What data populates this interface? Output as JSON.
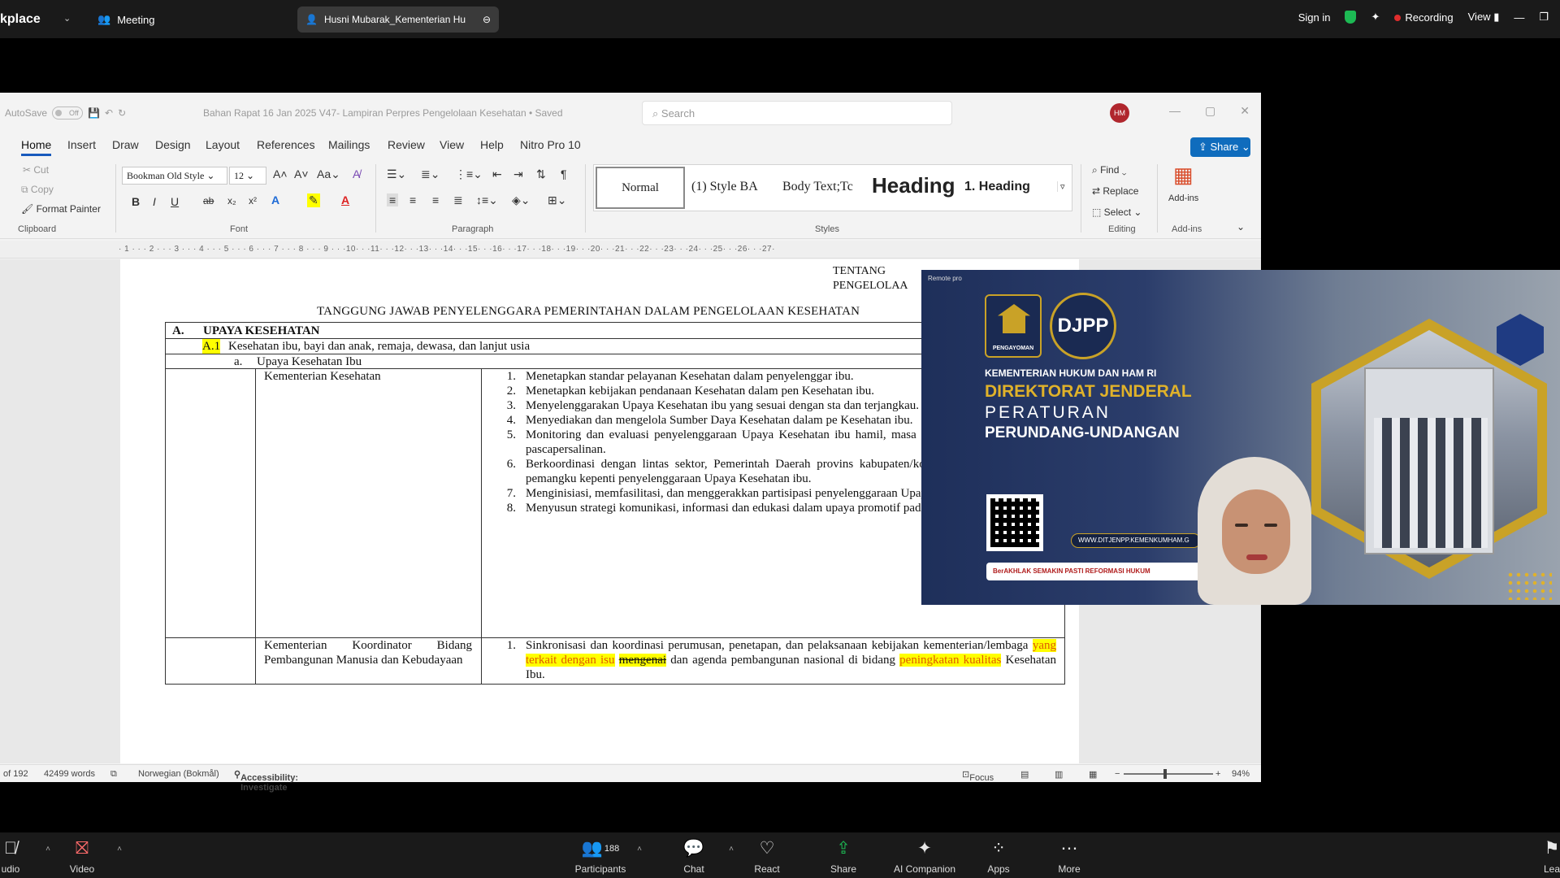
{
  "zoom_top": {
    "app_name": "kplace",
    "meeting_label": "Meeting",
    "share_label": "Husni Mubarak_Kementerian Hu",
    "sign_in": "Sign in",
    "recording": "Recording",
    "view": "View"
  },
  "word": {
    "autosave_label": "AutoSave",
    "autosave_state": "Off",
    "doc_title": "Bahan Rapat 16 Jan 2025 V47- Lampiran Perpres Pengelolaan Kesehatan • Saved",
    "search_placeholder": "Search",
    "avatar_initials": "HM",
    "tabs": [
      "Home",
      "Insert",
      "Draw",
      "Design",
      "Layout",
      "References",
      "Mailings",
      "Review",
      "View",
      "Help",
      "Nitro Pro 10"
    ],
    "share_label": "Share",
    "clipboard": {
      "cut": "Cut",
      "copy": "Copy",
      "format_painter": "Format Painter",
      "label": "Clipboard"
    },
    "font": {
      "name": "Bookman Old Style",
      "size": "12",
      "label": "Font"
    },
    "paragraph_label": "Paragraph",
    "styles": {
      "normal": "Normal",
      "style_ba": "(1)  Style BA",
      "body_text": "Body Text;Tc",
      "heading": "Heading",
      "heading1": "1.  Heading",
      "label": "Styles"
    },
    "editing": {
      "find": "Find",
      "replace": "Replace",
      "select": "Select",
      "label": "Editing"
    },
    "addins": {
      "button": "Add-ins",
      "label": "Add-ins"
    },
    "ruler_marks": "· 1 · · · 2 · · · 3 · · · 4 · · · 5 · · · 6 · · · 7 · · · 8 · · · 9 · · ·10· · ·11· · ·12· · ·13· · ·14· · ·15· · ·16· · ·17· · ·18· · ·19· · ·20· · ·21· · ·22· · ·23· · ·24· · ·25· · ·26· · ·27·",
    "document": {
      "tentang_1": "TENTANG",
      "tentang_2": "PENGELOLAA",
      "heading": "TANGGUNG JAWAB PENYELENGGARA PEMERINTAHAN DALAM PENGELOLAAN KESEHATAN",
      "section_letter": "A.",
      "section_title": "UPAYA KESEHATAN",
      "sub_code": "A.1",
      "sub_title": "Kesehatan ibu, bayi dan anak, remaja, dewasa, dan lanjut usia",
      "subsub_letter": "a.",
      "subsub_title": "Upaya Kesehatan Ibu",
      "row1_entity": "Kementerian Kesehatan",
      "row1_items": [
        {
          "n": "1.",
          "t": "Menetapkan standar pelayanan Kesehatan dalam penyelenggar ibu."
        },
        {
          "n": "2.",
          "t": "Menetapkan kebijakan pendanaan Kesehatan dalam pen Kesehatan ibu."
        },
        {
          "n": "3.",
          "t": "Menyelenggarakan Upaya Kesehatan ibu yang sesuai dengan sta dan terjangkau."
        },
        {
          "n": "4.",
          "t": "Menyediakan dan mengelola Sumber Daya Kesehatan dalam pe Kesehatan ibu."
        },
        {
          "n": "5.",
          "t": "Monitoring dan evaluasi penyelenggaraan Upaya Kesehatan ibu hamil, masa kehamilan, persalinan, dan pascapersalinan."
        },
        {
          "n": "6.",
          "t": "Berkoordinasi dengan lintas sektor, Pemerintah Daerah provins kabupaten/kota, Pemerintah Desa, dan pemangku kepenti penyelenggaraan Upaya Kesehatan ibu."
        },
        {
          "n": "7.",
          "t": "Menginisiasi, memfasilitasi, dan menggerakkan partisipasi penyelenggaraan Upaya Kesehatan ibu."
        },
        {
          "n": "8.",
          "t": "Menyusun strategi komunikasi, informasi dan edukasi dalam upaya promotif pada Upaya Kesehatan ibu."
        }
      ],
      "row2_entity": "Kementerian Koordinator Bidang Pembangunan Manusia dan Kebudayaan",
      "row2_n": "1.",
      "row2_t1": "Sinkronisasi dan koordinasi perumusan, penetapan, dan pelaksanaan kebijakan kementerian/lembaga ",
      "row2_hl1": "yang terkait dengan isu",
      "row2_strike": "mengenai",
      "row2_t2": " dan agenda pembangunan nasional di bidang ",
      "row2_hl2": "peningkatan kualitas",
      "row2_t3": " Kesehatan Ibu."
    },
    "status": {
      "page": "of 192",
      "words": "42499 words",
      "language": "Norwegian (Bokmål)",
      "accessibility": "Accessibility: Investigate",
      "focus": "Focus",
      "zoom": "94%"
    }
  },
  "video": {
    "top_label": "Remote pro",
    "logo1_caption": "PENGAYOMAN",
    "logo2_text": "DJPP",
    "ministry": "KEMENTERIAN HUKUM DAN HAM RI",
    "line1": "DIREKTORAT JENDERAL",
    "line2": "PERATURAN",
    "line3": "PERUNDANG-UNDANGAN",
    "url": "WWW.DITJENPP.KEMENKUMHAM.G",
    "brands": "BerAKHLAK   SEMAKIN PASTI   REFORMASI HUKUM"
  },
  "zoom_bottom": {
    "audio": "udio",
    "video": "Video",
    "participants": "Participants",
    "participants_count": "188",
    "chat": "Chat",
    "react": "React",
    "share": "Share",
    "ai": "AI Companion",
    "apps": "Apps",
    "more": "More",
    "edge": "Lea"
  }
}
